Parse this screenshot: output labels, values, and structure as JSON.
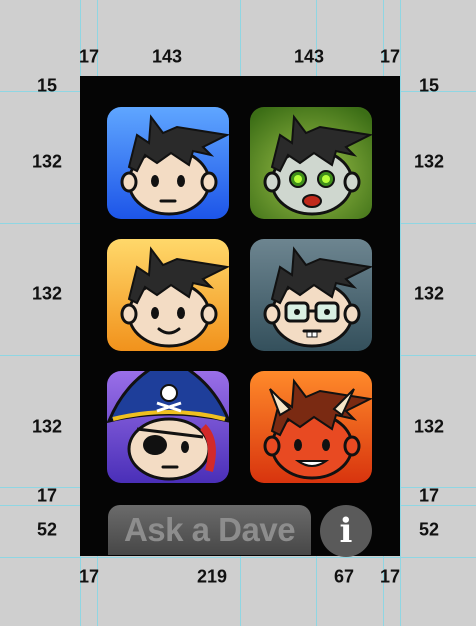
{
  "dimensions": {
    "top_margin_left": "15",
    "top_margin_right": "15",
    "row1_left": "132",
    "row1_right": "132",
    "row2_left": "132",
    "row2_right": "132",
    "row3_left": "132",
    "row3_right": "132",
    "bottom_gap_left": "17",
    "bottom_gap_right": "17",
    "bar_height_left": "52",
    "bar_height_right": "52",
    "top_left_margin": "17",
    "top_col1": "143",
    "top_col2": "143",
    "top_right_margin": "17",
    "bottom_left_margin": "17",
    "bottom_ask_width": "219",
    "bottom_info_width": "67",
    "bottom_right_margin": "17"
  },
  "avatars": [
    {
      "name": "classic-dave-icon",
      "bg_top": "#5fa6ff",
      "bg_bottom": "#1d55e8",
      "skin": "#f3dcc4"
    },
    {
      "name": "zombie-dave-icon",
      "bg_top": "#9ec24a",
      "bg_bottom": "#3c6e16",
      "skin": "#cfd7cf"
    },
    {
      "name": "happy-dave-icon",
      "bg_top": "#ffd86a",
      "bg_bottom": "#f1921c",
      "skin": "#f3dcc4"
    },
    {
      "name": "nerd-dave-icon",
      "bg_top": "#6d8590",
      "bg_bottom": "#34505c",
      "skin": "#f3dcc4"
    },
    {
      "name": "pirate-dave-icon",
      "bg_top": "#9a6fe8",
      "bg_bottom": "#4a2fb8",
      "skin": "#f3dcc4"
    },
    {
      "name": "devil-dave-icon",
      "bg_top": "#ff8a2a",
      "bg_bottom": "#d8340e",
      "skin": "#e84a22"
    }
  ],
  "footer": {
    "ask_label": "Ask a Dave",
    "info_label": "i"
  }
}
